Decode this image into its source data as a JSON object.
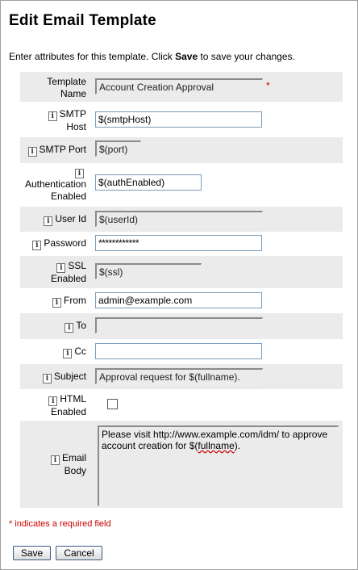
{
  "page": {
    "title": "Edit Email Template",
    "intro_before": "Enter attributes for this template. Click ",
    "intro_bold": "Save",
    "intro_after": " to save your changes."
  },
  "form": {
    "template_name": {
      "label_line1": "Template",
      "label_line2": "Name",
      "value": "Account Creation Approval",
      "required_mark": "*"
    },
    "smtp_host": {
      "label_line1": "SMTP",
      "label_line2": "Host",
      "value": "$(smtpHost)"
    },
    "smtp_port": {
      "label": "SMTP Port",
      "value": "$(port)"
    },
    "auth_enabled": {
      "label_line1": "Authentication",
      "label_line2": "Enabled",
      "value": "$(authEnabled)"
    },
    "user_id": {
      "label": "User Id",
      "value": "$(userId)"
    },
    "password": {
      "label": "Password",
      "value": "************"
    },
    "ssl_enabled": {
      "label_line1": "SSL",
      "label_line2": "Enabled",
      "value": "$(ssl)"
    },
    "from": {
      "label": "From",
      "value": "admin@example.com"
    },
    "to": {
      "label": "To",
      "value": ""
    },
    "cc": {
      "label": "Cc",
      "value": ""
    },
    "subject": {
      "label": "Subject",
      "value": "Approval request for $(fullname)."
    },
    "html_enabled": {
      "label_line1": "HTML",
      "label_line2": "Enabled",
      "checked": false
    },
    "email_body": {
      "label_line1": "Email",
      "label_line2": "Body",
      "line1": "Please visit http://www.example.com/idm/ to approve",
      "line2_before": "account creation for $(",
      "line2_underlined": "fullname",
      "line2_after": ")."
    }
  },
  "footer": {
    "required_note": "* indicates a required field",
    "save_label": "Save",
    "cancel_label": "Cancel"
  },
  "icons": {
    "info_glyph": "i"
  },
  "colors": {
    "required": "#cc0000",
    "row_shade": "#ebebeb",
    "button_border": "#3b5a86"
  }
}
